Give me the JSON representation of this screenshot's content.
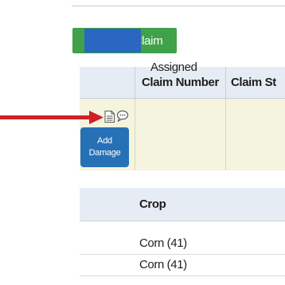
{
  "toolbar": {
    "report_claim_label": "Report a Claim"
  },
  "claims_table": {
    "headers": [
      "Claim Number",
      "Claim St"
    ],
    "rows": [
      {
        "status": "Assigned",
        "swatch_color": "#2b66c2"
      }
    ]
  },
  "row_actions": {
    "icons": [
      "document-icon",
      "comment-icon"
    ],
    "add_damage_lines": [
      "Add",
      "Damage"
    ]
  },
  "annotation": {
    "arrow_color": "#d12027"
  },
  "crop_table": {
    "header": "Crop",
    "rows": [
      "Corn (41)",
      "Corn (41)"
    ]
  },
  "colors": {
    "report_button": "#3fa149",
    "add_damage_button": "#2671b6",
    "header_bg": "#e6ecf3",
    "highlight_row_bg": "#f4f4df"
  }
}
